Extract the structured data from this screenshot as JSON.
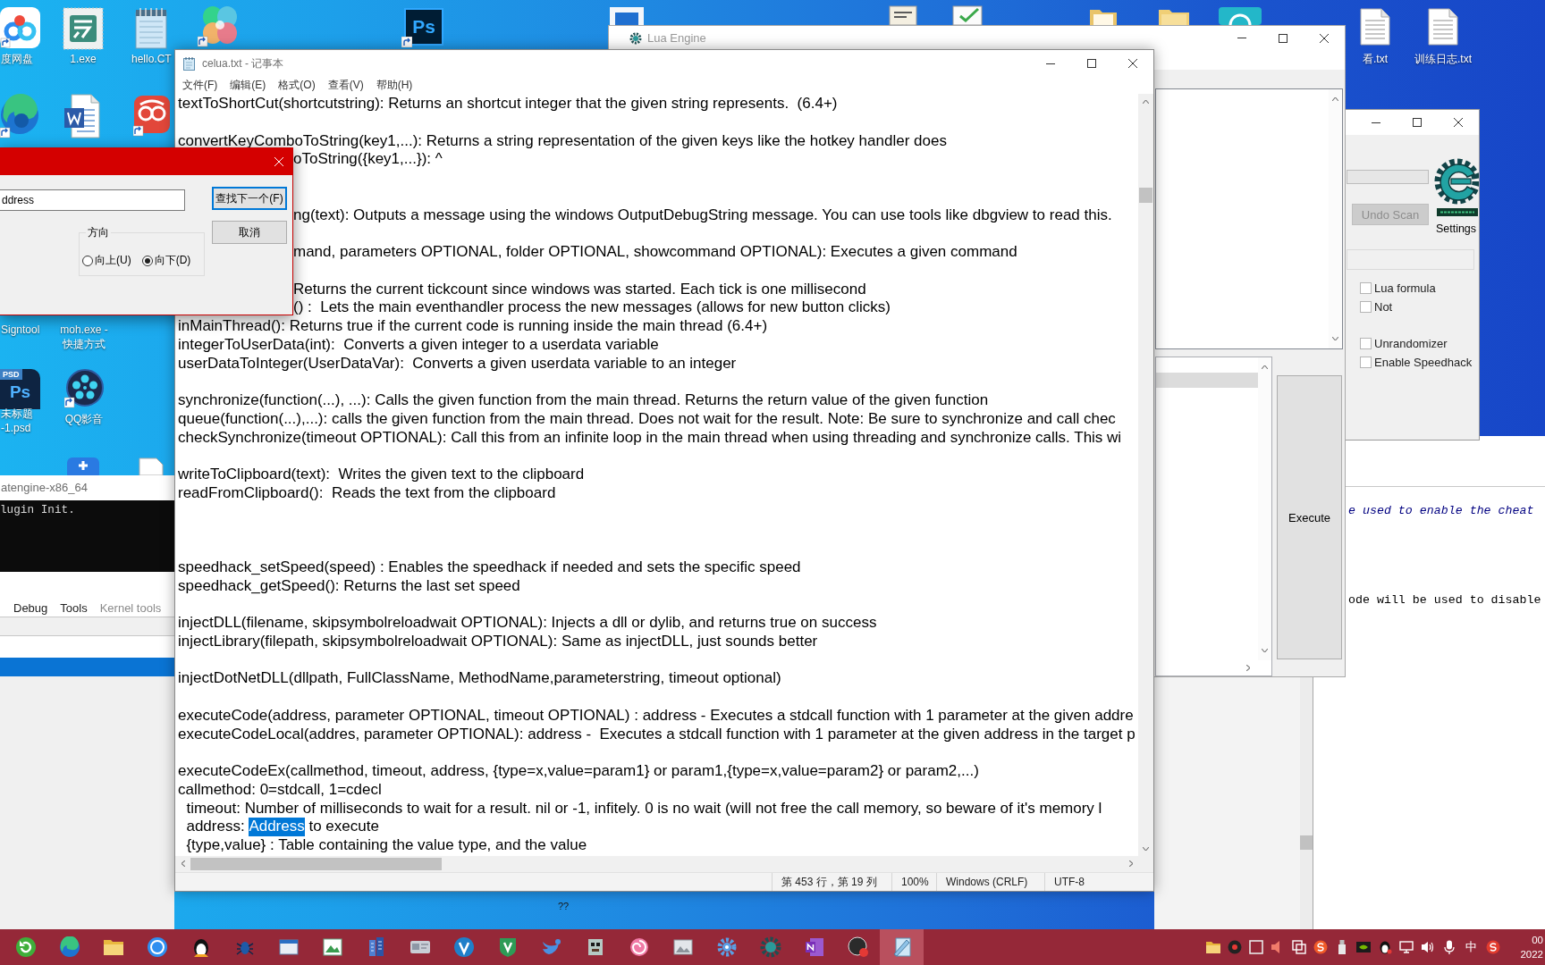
{
  "desktop": {
    "icons": [
      {
        "label": [
          "度网盘"
        ]
      },
      {
        "label": [
          "1.exe"
        ]
      },
      {
        "label": [
          "hello.CT"
        ]
      },
      {
        "icon_text": "Ps"
      },
      {
        "label": [
          "Signtool"
        ]
      },
      {
        "label": [
          "moh.exe -",
          "快捷方式"
        ]
      },
      {
        "badge": "PSD",
        "icon_text": "Ps",
        "label": [
          "未标题",
          "-1.psd"
        ]
      },
      {
        "label": [
          "QQ影音"
        ]
      },
      {
        "label": [
          "看.txt"
        ]
      },
      {
        "label": [
          "训练日志.txt"
        ]
      }
    ],
    "stray_text": "??"
  },
  "lua_engine": {
    "title": "Lua Engine",
    "list_rows": [
      {
        "selected": true
      }
    ],
    "execute": "Execute"
  },
  "cheat_engine": {
    "scan_progress": {
      "level": 0
    },
    "undo_scan": {
      "label": "Undo Scan",
      "disabled": true
    },
    "settings": "Settings",
    "option_groups": [
      {
        "options": [
          {
            "label": "Lua formula",
            "checked": false
          },
          {
            "label": "Not",
            "checked": false
          }
        ]
      },
      {
        "options": [
          {
            "label": "Unrandomizer",
            "checked": false
          },
          {
            "label": "Enable Speedhack",
            "checked": false
          }
        ]
      }
    ]
  },
  "script_editor": {
    "lines": [
      {
        "kind": "comment",
        "text": "e used to enable the cheat"
      },
      {
        "kind": "blank"
      },
      {
        "kind": "blank"
      },
      {
        "kind": "blank"
      },
      {
        "kind": "blank"
      },
      {
        "kind": "code",
        "text": "ode will be used to disable"
      }
    ]
  },
  "console": {
    "title": "atengine-x86_64",
    "output": "lugin Init."
  },
  "memory_viewer": {
    "menu": [
      {
        "label": "Debug",
        "disabled": false
      },
      {
        "label": "Tools",
        "disabled": false
      },
      {
        "label": "Kernel tools",
        "disabled": true
      }
    ],
    "rows": [
      {
        "selected": true
      }
    ]
  },
  "notepad": {
    "title": "celua.txt - 记事本",
    "menu": [
      "文件(F)",
      "编辑(E)",
      "格式(O)",
      "查看(V)",
      "帮助(H)"
    ],
    "lines": [
      {
        "kind": "text",
        "text": "textToShortCut(shortcutstring): Returns an shortcut integer that the given string represents.  (6.4+)"
      },
      {
        "kind": "blank"
      },
      {
        "kind": "text",
        "text": "convertKeyComboToString(key1,...): Returns a string representation of the given keys like the hotkey handler does"
      },
      {
        "kind": "covered",
        "text": "oToString({key1,...}): ^"
      },
      {
        "kind": "blank"
      },
      {
        "kind": "blank"
      },
      {
        "kind": "covered",
        "text": "ng(text): Outputs a message using the windows OutputDebugString message. You can use tools like dbgview to read this."
      },
      {
        "kind": "blank"
      },
      {
        "kind": "covered",
        "text": "mand, parameters OPTIONAL, folder OPTIONAL, showcommand OPTIONAL): Executes a given command"
      },
      {
        "kind": "blank"
      },
      {
        "kind": "covered",
        "text": "Returns the current tickcount since windows was started. Each tick is one millisecond"
      },
      {
        "kind": "covered",
        "text": "() :  Lets the main eventhandler process the new messages (allows for new button clicks)"
      },
      {
        "kind": "text",
        "text": "inMainThread(): Returns true if the current code is running inside the main thread (6.4+)"
      },
      {
        "kind": "text",
        "text": "integerToUserData(int):  Converts a given integer to a userdata variable"
      },
      {
        "kind": "text",
        "text": "userDataToInteger(UserDataVar):  Converts a given userdata variable to an integer"
      },
      {
        "kind": "blank"
      },
      {
        "kind": "text",
        "text": "synchronize(function(...), ...): Calls the given function from the main thread. Returns the return value of the given function"
      },
      {
        "kind": "text",
        "text": "queue(function(...),...): calls the given function from the main thread. Does not wait for the result. Note: Be sure to synchronize and call chec"
      },
      {
        "kind": "text",
        "text": "checkSynchronize(timeout OPTIONAL): Call this from an infinite loop in the main thread when using threading and synchronize calls. This wi"
      },
      {
        "kind": "blank"
      },
      {
        "kind": "text",
        "text": "writeToClipboard(text):  Writes the given text to the clipboard"
      },
      {
        "kind": "text",
        "text": "readFromClipboard():  Reads the text from the clipboard"
      },
      {
        "kind": "blank"
      },
      {
        "kind": "blank"
      },
      {
        "kind": "blank"
      },
      {
        "kind": "text",
        "text": "speedhack_setSpeed(speed) : Enables the speedhack if needed and sets the specific speed"
      },
      {
        "kind": "text",
        "text": "speedhack_getSpeed(): Returns the last set speed"
      },
      {
        "kind": "blank"
      },
      {
        "kind": "text",
        "text": "injectDLL(filename, skipsymbolreloadwait OPTIONAL): Injects a dll or dylib, and returns true on success"
      },
      {
        "kind": "text",
        "text": "injectLibrary(filepath, skipsymbolreloadwait OPTIONAL): Same as injectDLL, just sounds better"
      },
      {
        "kind": "blank"
      },
      {
        "kind": "text",
        "text": "injectDotNetDLL(dllpath, FullClassName, MethodName,parameterstring, timeout optional)"
      },
      {
        "kind": "blank"
      },
      {
        "kind": "text",
        "text": "executeCode(address, parameter OPTIONAL, timeout OPTIONAL) : address - Executes a stdcall function with 1 parameter at the given addre"
      },
      {
        "kind": "text",
        "text": "executeCodeLocal(addres, parameter OPTIONAL): address -  Executes a stdcall function with 1 parameter at the given address in the target p"
      },
      {
        "kind": "blank"
      },
      {
        "kind": "text",
        "text": "executeCodeEx(callmethod, timeout, address, {type=x,value=param1} or param1,{type=x,value=param2} or param2,...)"
      },
      {
        "kind": "text",
        "text": "callmethod: 0=stdcall, 1=cdecl"
      },
      {
        "kind": "text",
        "text": "  timeout: Number of milliseconds to wait for a result. nil or -1, infitely. 0 is no wait (will not free the call memory, so beware of it's memory l"
      },
      {
        "kind": "segments",
        "segments": [
          {
            "text": "  address: ",
            "selected": false
          },
          {
            "text": "Address",
            "selected": true
          },
          {
            "text": " to execute",
            "selected": false
          }
        ]
      },
      {
        "kind": "text",
        "text": "  {type,value} : Table containing the value type, and the value"
      }
    ],
    "status": {
      "position": "第 453 行，第 19 列",
      "zoom": "100%",
      "line_ending": "Windows (CRLF)",
      "encoding": "UTF-8"
    }
  },
  "find_dialog": {
    "search_value": "ddress",
    "find_next": "查找下一个(F)",
    "cancel": "取消",
    "direction": {
      "label": "方向",
      "options": [
        {
          "label": "向上(U)",
          "selected": false
        },
        {
          "label": "向下(D)",
          "selected": true
        }
      ]
    }
  },
  "taskbar": {
    "apps": [
      {
        "selected": false
      },
      {
        "selected": false
      },
      {
        "selected": false
      },
      {
        "selected": false
      },
      {
        "selected": false
      },
      {
        "selected": false
      },
      {
        "selected": false
      },
      {
        "selected": false
      },
      {
        "selected": false
      },
      {
        "selected": false
      },
      {
        "selected": false
      },
      {
        "selected": false
      },
      {
        "selected": false
      },
      {
        "selected": false
      },
      {
        "selected": false
      },
      {
        "selected": false
      },
      {
        "selected": false
      },
      {
        "selected": false
      },
      {
        "selected": false
      },
      {
        "selected": false
      },
      {
        "selected": true
      }
    ],
    "input_method": "中",
    "clock": [
      "00",
      "2022"
    ]
  }
}
